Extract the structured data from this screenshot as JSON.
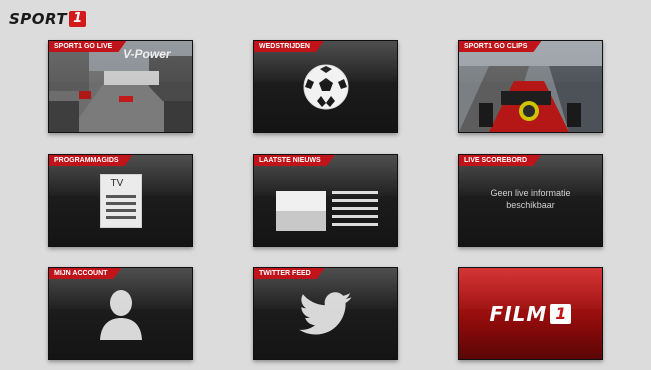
{
  "brand": {
    "logo_word": "SPORT",
    "logo_number": "1"
  },
  "tiles": [
    {
      "label": "SPORT1 GO LIVE",
      "overlay": "V-Power"
    },
    {
      "label": "WEDSTRIJDEN"
    },
    {
      "label": "SPORT1 GO CLIPS"
    },
    {
      "label": "PROGRAMMAGIDS",
      "icon_text": "TV"
    },
    {
      "label": "LAATSTE NIEUWS"
    },
    {
      "label": "LIVE SCOREBORD",
      "message": "Geen live informatie beschikbaar"
    },
    {
      "label": "MIJN ACCOUNT"
    },
    {
      "label": "TWITTER FEED"
    },
    {
      "label": "",
      "brand_word": "FILM",
      "brand_number": "1"
    }
  ],
  "colors": {
    "accent": "#c0141a",
    "background": "#dcdcdc",
    "tile": "#1c1c1c"
  }
}
